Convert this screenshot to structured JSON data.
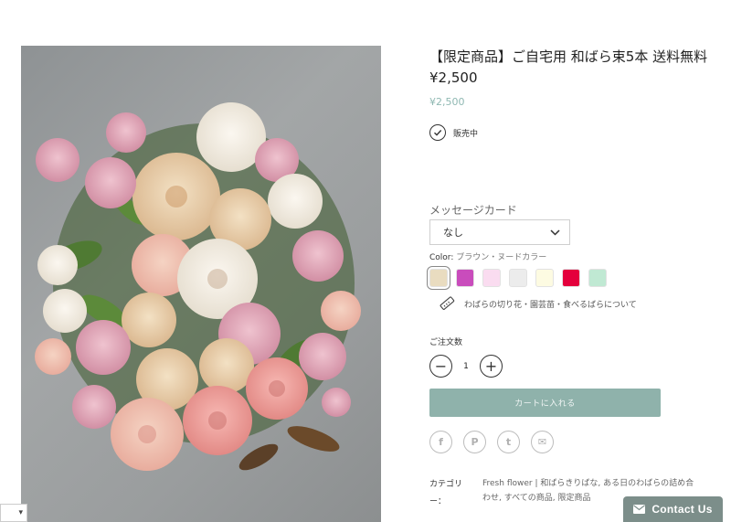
{
  "product": {
    "title": "【限定商品】ご自宅用 和ばら束5本 送料無料",
    "price": "¥2,500",
    "price_sub": "¥2,500",
    "stock_status": "販売中"
  },
  "options": {
    "message_card_label": "メッセージカード",
    "message_card_value": "なし",
    "color_label": "Color:",
    "color_value": "ブラウン・ヌードカラー",
    "swatches": [
      {
        "name": "brown-nude",
        "color": "#e9dcc0",
        "selected": true
      },
      {
        "name": "magenta",
        "color": "#c94cbc"
      },
      {
        "name": "light-pink",
        "color": "#fadcf0"
      },
      {
        "name": "light-gray",
        "color": "#ececec"
      },
      {
        "name": "cream",
        "color": "#fdfbe2"
      },
      {
        "name": "red",
        "color": "#e4003c"
      },
      {
        "name": "mint",
        "color": "#c0e9d3"
      }
    ],
    "info_link": "わばらの切り花・園芸苗・食べるばらについて"
  },
  "quantity": {
    "label": "ご注文数",
    "minus": "−",
    "value": "1",
    "plus": "+"
  },
  "cart_button": "カートに入れる",
  "share": {
    "facebook": "f",
    "pinterest": "P",
    "twitter": "t",
    "email": "✉"
  },
  "category": {
    "label": "カテゴリー：",
    "value": "Fresh flower | 和ばらきりばな, ある日のわばらの詰め合わせ, すべての商品, 限定商品"
  },
  "contact_button": "Contact Us",
  "lang_select_arrow": "▾"
}
